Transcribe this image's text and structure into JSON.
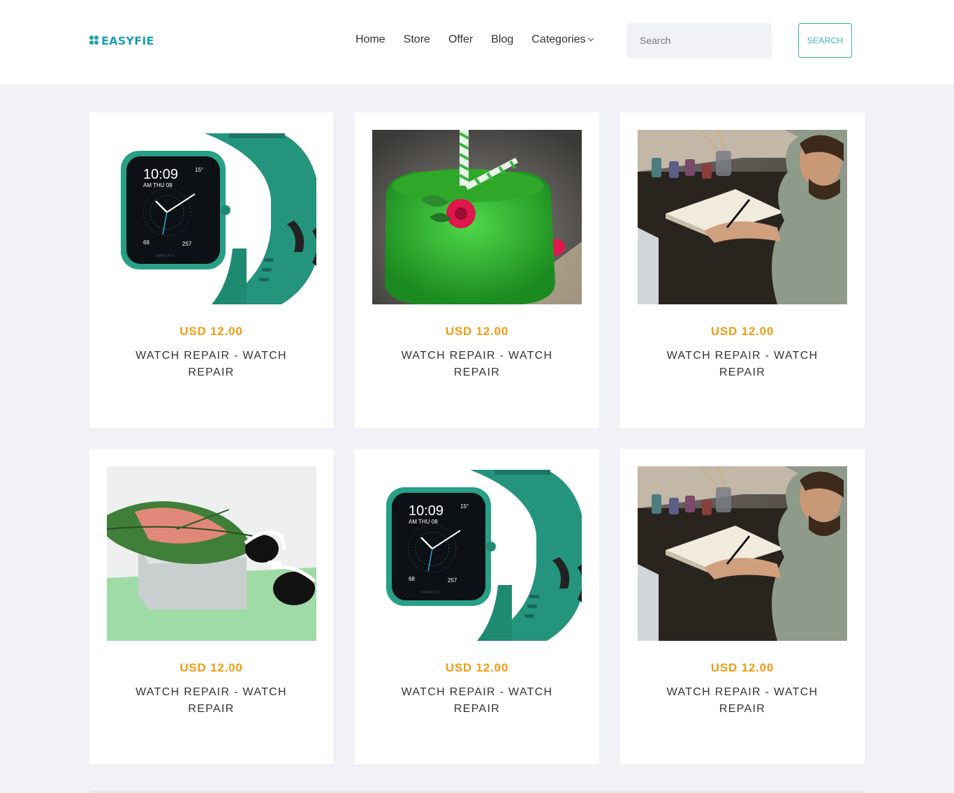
{
  "brand": {
    "name": "EASYFIE"
  },
  "nav": {
    "items": [
      {
        "label": "Home"
      },
      {
        "label": "Store"
      },
      {
        "label": "Offer"
      },
      {
        "label": "Blog"
      },
      {
        "label": "Categories"
      }
    ]
  },
  "search": {
    "placeholder": "Search",
    "button_label": "SEARCH"
  },
  "products": [
    {
      "image": "smartwatch-image",
      "price": "USD 12.00",
      "title": "WATCH REPAIR - WATCH REPAIR"
    },
    {
      "image": "green-smoothie-image",
      "price": "USD 12.00",
      "title": "WATCH REPAIR - WATCH REPAIR"
    },
    {
      "image": "man-drawing-image",
      "price": "USD 12.00",
      "title": "WATCH REPAIR - WATCH REPAIR"
    },
    {
      "image": "sunglasses-leaf-image",
      "price": "USD 12.00",
      "title": "WATCH REPAIR - WATCH REPAIR"
    },
    {
      "image": "smartwatch-image",
      "price": "USD 12.00",
      "title": "WATCH REPAIR - WATCH REPAIR"
    },
    {
      "image": "man-drawing-image",
      "price": "USD 12.00",
      "title": "WATCH REPAIR - WATCH REPAIR"
    }
  ],
  "watch_face": {
    "time": "10:09",
    "am_day": "AM THU 08",
    "temp": "15°",
    "heart": "68",
    "kcal": "257",
    "brand": "AMAZFIT"
  },
  "colors": {
    "accent": "#1d9fb0",
    "button": "#37b1a9",
    "price": "#f59a12",
    "background": "#f1f2f7"
  }
}
